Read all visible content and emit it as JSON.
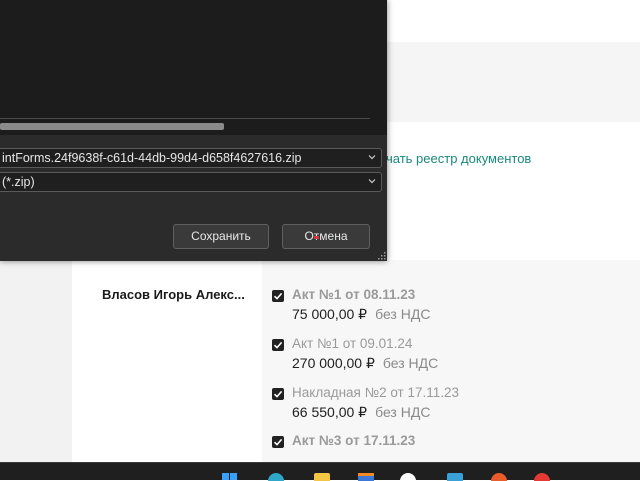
{
  "page": {
    "link_text": "чать реестр документов",
    "person_name": "Власов Игорь Алекс...",
    "documents": [
      {
        "title": "Акт №1 от 08.11.23",
        "amount": "75 000,00 ₽",
        "vat": "без НДС",
        "checked": true
      },
      {
        "title": "Акт №1 от 09.01.24",
        "amount": "270 000,00 ₽",
        "vat": "без НДС",
        "checked": true
      },
      {
        "title": "Накладная №2 от 17.11.23",
        "amount": "66 550,00 ₽",
        "vat": "без НДС",
        "checked": true
      },
      {
        "title": "Акт №3 от 17.11.23",
        "amount": "",
        "vat": "",
        "checked": true
      }
    ]
  },
  "dialog": {
    "file_name": "intForms.24f9638f-c61d-44db-99d4-d658f4627616.zip",
    "file_type": "(*.zip)",
    "save_label": "Сохранить",
    "cancel_label": "Отмена"
  },
  "taskbar": {
    "icons": [
      "windows-start-icon",
      "edge-icon",
      "file-explorer-icon",
      "store-icon",
      "yandex-icon",
      "settings-icon",
      "app-icon",
      "browser-red-icon"
    ]
  },
  "colors": {
    "link": "#1a8a7a",
    "dialog_bg": "#2b2b2b",
    "dialog_top": "#1c1c1c",
    "taskbar": "#1f1f1f"
  }
}
